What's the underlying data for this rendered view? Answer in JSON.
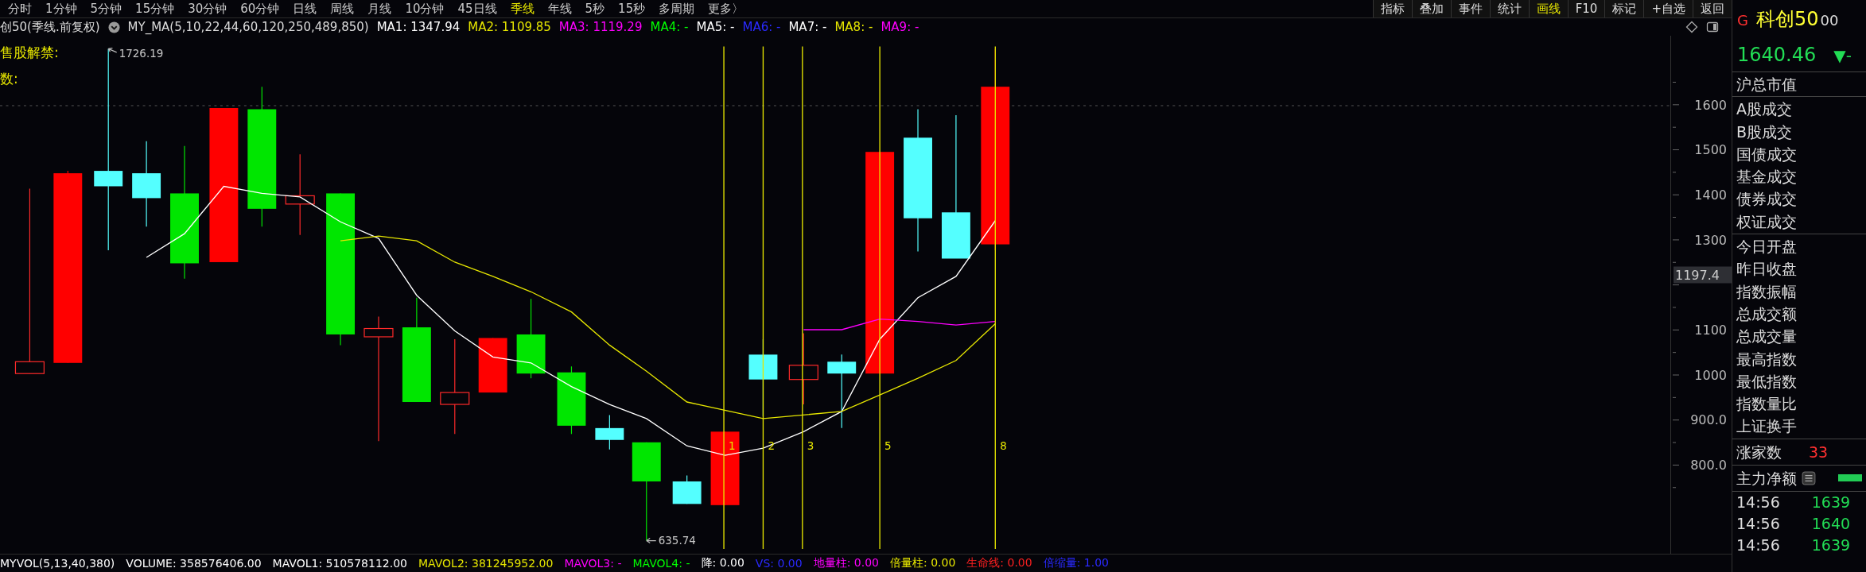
{
  "top_bar": {
    "periods": [
      {
        "label": "分时",
        "selected": false
      },
      {
        "label": "1分钟",
        "selected": false
      },
      {
        "label": "5分钟",
        "selected": false
      },
      {
        "label": "15分钟",
        "selected": false
      },
      {
        "label": "30分钟",
        "selected": false
      },
      {
        "label": "60分钟",
        "selected": false
      },
      {
        "label": "日线",
        "selected": false
      },
      {
        "label": "周线",
        "selected": false
      },
      {
        "label": "月线",
        "selected": false
      },
      {
        "label": "10分钟",
        "selected": false
      },
      {
        "label": "45日线",
        "selected": false
      },
      {
        "label": "季线",
        "selected": true
      },
      {
        "label": "年线",
        "selected": false
      },
      {
        "label": "5秒",
        "selected": false
      },
      {
        "label": "15秒",
        "selected": false
      },
      {
        "label": "多周期",
        "selected": false
      },
      {
        "label": "更多〉",
        "selected": false
      }
    ],
    "tools": [
      {
        "label": "指标",
        "selected": false
      },
      {
        "label": "叠加",
        "selected": false
      },
      {
        "label": "事件",
        "selected": false
      },
      {
        "label": "统计",
        "selected": false
      },
      {
        "label": "画线",
        "selected": true
      },
      {
        "label": "F10",
        "selected": false
      },
      {
        "label": "标记",
        "selected": false
      },
      {
        "label": "+自选",
        "selected": false
      },
      {
        "label": "返回",
        "selected": false
      }
    ]
  },
  "legend": {
    "title": "创50(季线.前复权)",
    "indicator": "MY_MA(5,10,22,44,60,120,250,489,850)",
    "values": [
      {
        "text": "MA1: 1347.94",
        "color": "#ffffff"
      },
      {
        "text": "MA2: 1109.85",
        "color": "#e6e600"
      },
      {
        "text": "MA3: 1119.29",
        "color": "#ff00ff"
      },
      {
        "text": "MA4: -",
        "color": "#00ff00"
      },
      {
        "text": "MA5: -",
        "color": "#ffffff"
      },
      {
        "text": "MA6: -",
        "color": "#2a2aff"
      },
      {
        "text": "MA7: -",
        "color": "#ffffff"
      },
      {
        "text": "MA8: -",
        "color": "#e6e600"
      },
      {
        "text": "MA9: -",
        "color": "#ff00ff"
      }
    ]
  },
  "chart": {
    "notes": [
      "售股解禁:",
      "数:"
    ],
    "high_label": "1726.19",
    "low_label": "635.74",
    "markers": [
      "1",
      "2",
      "3",
      "5",
      "8"
    ],
    "y_ticks": [
      "1600",
      "1500",
      "1400",
      "1300",
      "1100",
      "1000",
      "900.0",
      "800.0"
    ],
    "current_price": "1197.4"
  },
  "volume_legend": [
    {
      "text": "MYVOL(5,13,40,380)",
      "color": "#ffffff"
    },
    {
      "text": "VOLUME: 358576406.00",
      "color": "#ffffff"
    },
    {
      "text": "MAVOL1: 510578112.00",
      "color": "#ffffff"
    },
    {
      "text": "MAVOL2: 381245952.00",
      "color": "#e6e600"
    },
    {
      "text": "MAVOL3: -",
      "color": "#ff00ff"
    },
    {
      "text": "MAVOL4: -",
      "color": "#00ff00"
    },
    {
      "text": "降: 0.00",
      "color": "#ffffff"
    },
    {
      "text": "VS: 0.00",
      "color": "#2a2aff"
    },
    {
      "text": "地量柱: 0.00",
      "color": "#ff00ff"
    },
    {
      "text": "倍量柱: 0.00",
      "color": "#e6e600"
    },
    {
      "text": "生命线: 0.00",
      "color": "#ff2020"
    },
    {
      "text": "倍缩量: 1.00",
      "color": "#2a2aff"
    }
  ],
  "quote_panel": {
    "market": "G",
    "name": "科创50",
    "code": "00",
    "price": "1640.46",
    "change": "▼-",
    "sections": [
      [
        "沪总市值"
      ],
      [
        "A股成交",
        "B股成交",
        "国债成交",
        "基金成交",
        "债券成交",
        "权证成交"
      ],
      [
        "今日开盘",
        "昨日收盘",
        "指数振幅",
        "总成交额",
        "总成交量",
        "最高指数",
        "最低指数",
        "指数量比",
        "上证换手"
      ]
    ],
    "advancers": {
      "label": "涨家数",
      "value": "33"
    },
    "main_net": {
      "label": "主力净额"
    },
    "ticks": [
      {
        "time": "14:56",
        "price": "1639"
      },
      {
        "time": "14:56",
        "price": "1640"
      },
      {
        "time": "14:56",
        "price": "1639"
      }
    ]
  }
}
